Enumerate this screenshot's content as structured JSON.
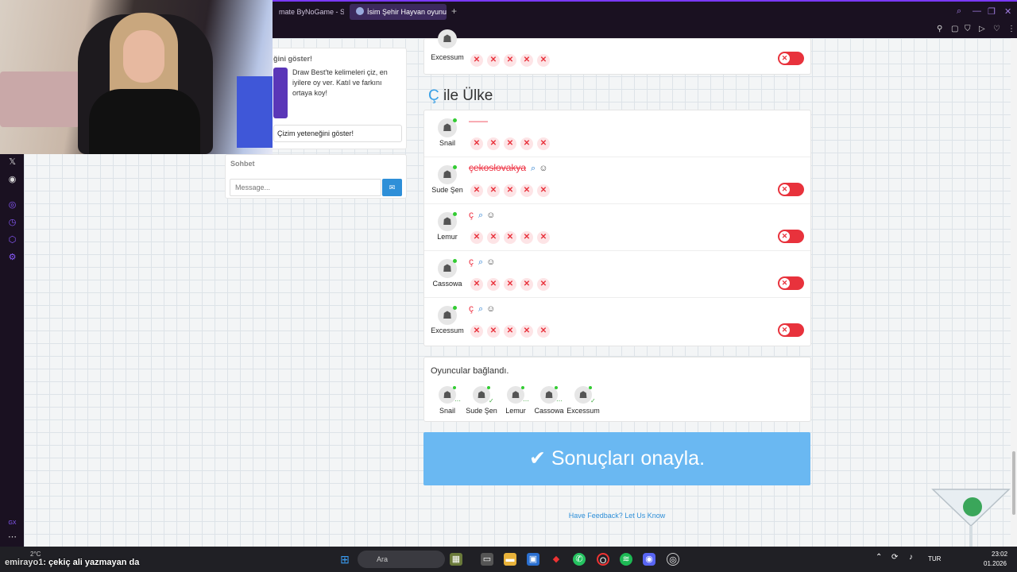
{
  "browser": {
    "tabs": [
      {
        "label": "mate ByNoGame - Strea",
        "active": false
      },
      {
        "label": "İsim Şehir Hayvan oyunun",
        "active": true
      }
    ],
    "new_tab": "+"
  },
  "side_panel": {
    "promo_title": "ğini göster!",
    "promo_text": "Draw Best'te kelimeleri çiz, en iyilere oy ver. Katıl ve farkını ortaya koy!",
    "promo_link": "Çizim yeteneğini göster!",
    "chat_title": "Sohbet",
    "chat_placeholder": "Message..."
  },
  "top_partial": {
    "player": "Excessum"
  },
  "category": {
    "letter": "Ç",
    "name": "ile Ülke"
  },
  "answers": [
    {
      "player": "Snail",
      "answer": "——",
      "struck": false,
      "show_toggle": false
    },
    {
      "player": "Sude Şen",
      "answer": "çekoslovakya",
      "struck": true,
      "show_toggle": true
    },
    {
      "player": "Lemur",
      "answer": "ç",
      "struck": false,
      "show_toggle": true
    },
    {
      "player": "Cassowa",
      "answer": "ç",
      "struck": false,
      "show_toggle": true
    },
    {
      "player": "Excessum",
      "answer": "ç",
      "struck": false,
      "show_toggle": true
    }
  ],
  "connected": {
    "label": "Oyuncular bağlandı.",
    "players": [
      "Snail",
      "Sude Şen",
      "Lemur",
      "Cassowa",
      "Excessum"
    ]
  },
  "confirm_button": "Sonuçları onayla.",
  "feedback_link": "Have Feedback? Let Us Know",
  "taskbar": {
    "weather": "2°C",
    "search": "Ara",
    "lang": "TUR",
    "time": "23:02",
    "date": "01.2026"
  },
  "stream_chat": {
    "user": "emirayo1",
    "message": ": çekiç ali yazmayan da"
  },
  "colors": {
    "accent": "#6ab8f2",
    "reject": "#e8323c",
    "link": "#2e8fd8"
  }
}
